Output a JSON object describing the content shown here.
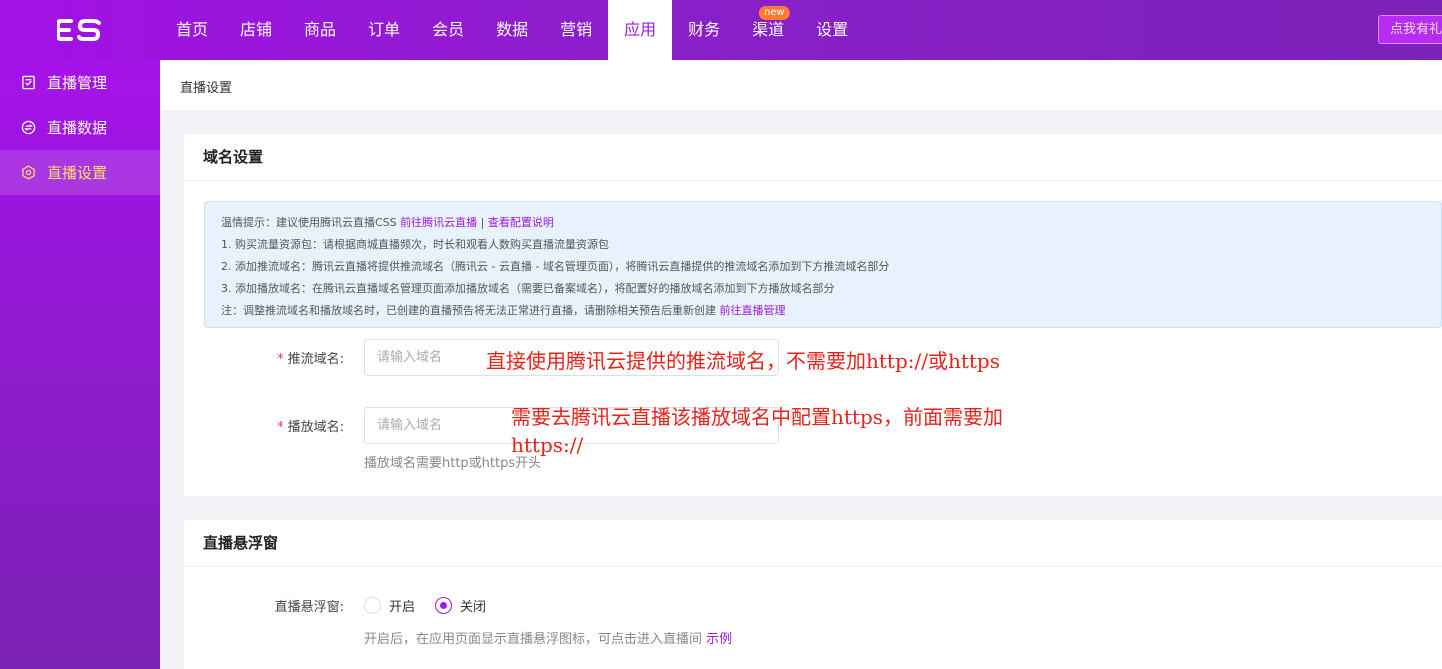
{
  "header": {
    "logo_text": "ES",
    "nav": [
      {
        "label": "首页",
        "active": false
      },
      {
        "label": "店铺",
        "active": false
      },
      {
        "label": "商品",
        "active": false
      },
      {
        "label": "订单",
        "active": false
      },
      {
        "label": "会员",
        "active": false
      },
      {
        "label": "数据",
        "active": false
      },
      {
        "label": "营销",
        "active": false
      },
      {
        "label": "应用",
        "active": true
      },
      {
        "label": "财务",
        "active": false
      },
      {
        "label": "渠道",
        "active": false,
        "badge": "new"
      },
      {
        "label": "设置",
        "active": false
      }
    ],
    "right_button": "点我有礼"
  },
  "sidebar": {
    "items": [
      {
        "label": "直播管理",
        "icon": "checklist-icon",
        "active": false
      },
      {
        "label": "直播数据",
        "icon": "exchange-icon",
        "active": false
      },
      {
        "label": "直播设置",
        "icon": "hexagon-settings-icon",
        "active": true
      }
    ]
  },
  "breadcrumb": "直播设置",
  "domain_card": {
    "title": "域名设置",
    "tip": {
      "intro": "温情提示：建议使用腾讯云直播CSS",
      "link1": "前往腾讯云直播",
      "sep": "|",
      "link2": "查看配置说明",
      "line1": "1. 购买流量资源包：请根据商城直播频次，时长和观看人数购买直播流量资源包",
      "line2": "2. 添加推流域名：腾讯云直播将提供推流域名（腾讯云 - 云直播 - 域名管理页面），将腾讯云直播提供的推流域名添加到下方推流域名部分",
      "line3": "3. 添加播放域名：在腾讯云直播域名管理页面添加播放域名（需要已备案域名），将配置好的播放域名添加到下方播放域名部分",
      "note": "注：调整推流域名和播放域名时，已创建的直播预告将无法正常进行直播，请删除相关预告后重新创建",
      "note_link": "前往直播管理"
    },
    "push_label": "推流域名:",
    "push_placeholder": "请输入域名",
    "play_label": "播放域名:",
    "play_placeholder": "请输入域名",
    "play_help": "播放域名需要http或https开头",
    "required_mark": "*"
  },
  "float_card": {
    "title": "直播悬浮窗",
    "label": "直播悬浮窗:",
    "options": [
      {
        "label": "开启",
        "checked": false
      },
      {
        "label": "关闭",
        "checked": true
      }
    ],
    "help": "开启后，在应用页面显示直播悬浮图标，可点击进入直播间",
    "help_link": "示例"
  },
  "annotations": {
    "push_note": "直接使用腾讯云提供的推流域名，不需要加http://或https",
    "play_note_line1": "需要去腾讯云直播该播放域名中配置https，前面需要加",
    "play_note_line2": "https://"
  },
  "colors": {
    "brand": "#9c1ade",
    "annotation": "#e8231c",
    "badge": "#ff7a32",
    "active_sidebar_text": "#ffe066"
  }
}
